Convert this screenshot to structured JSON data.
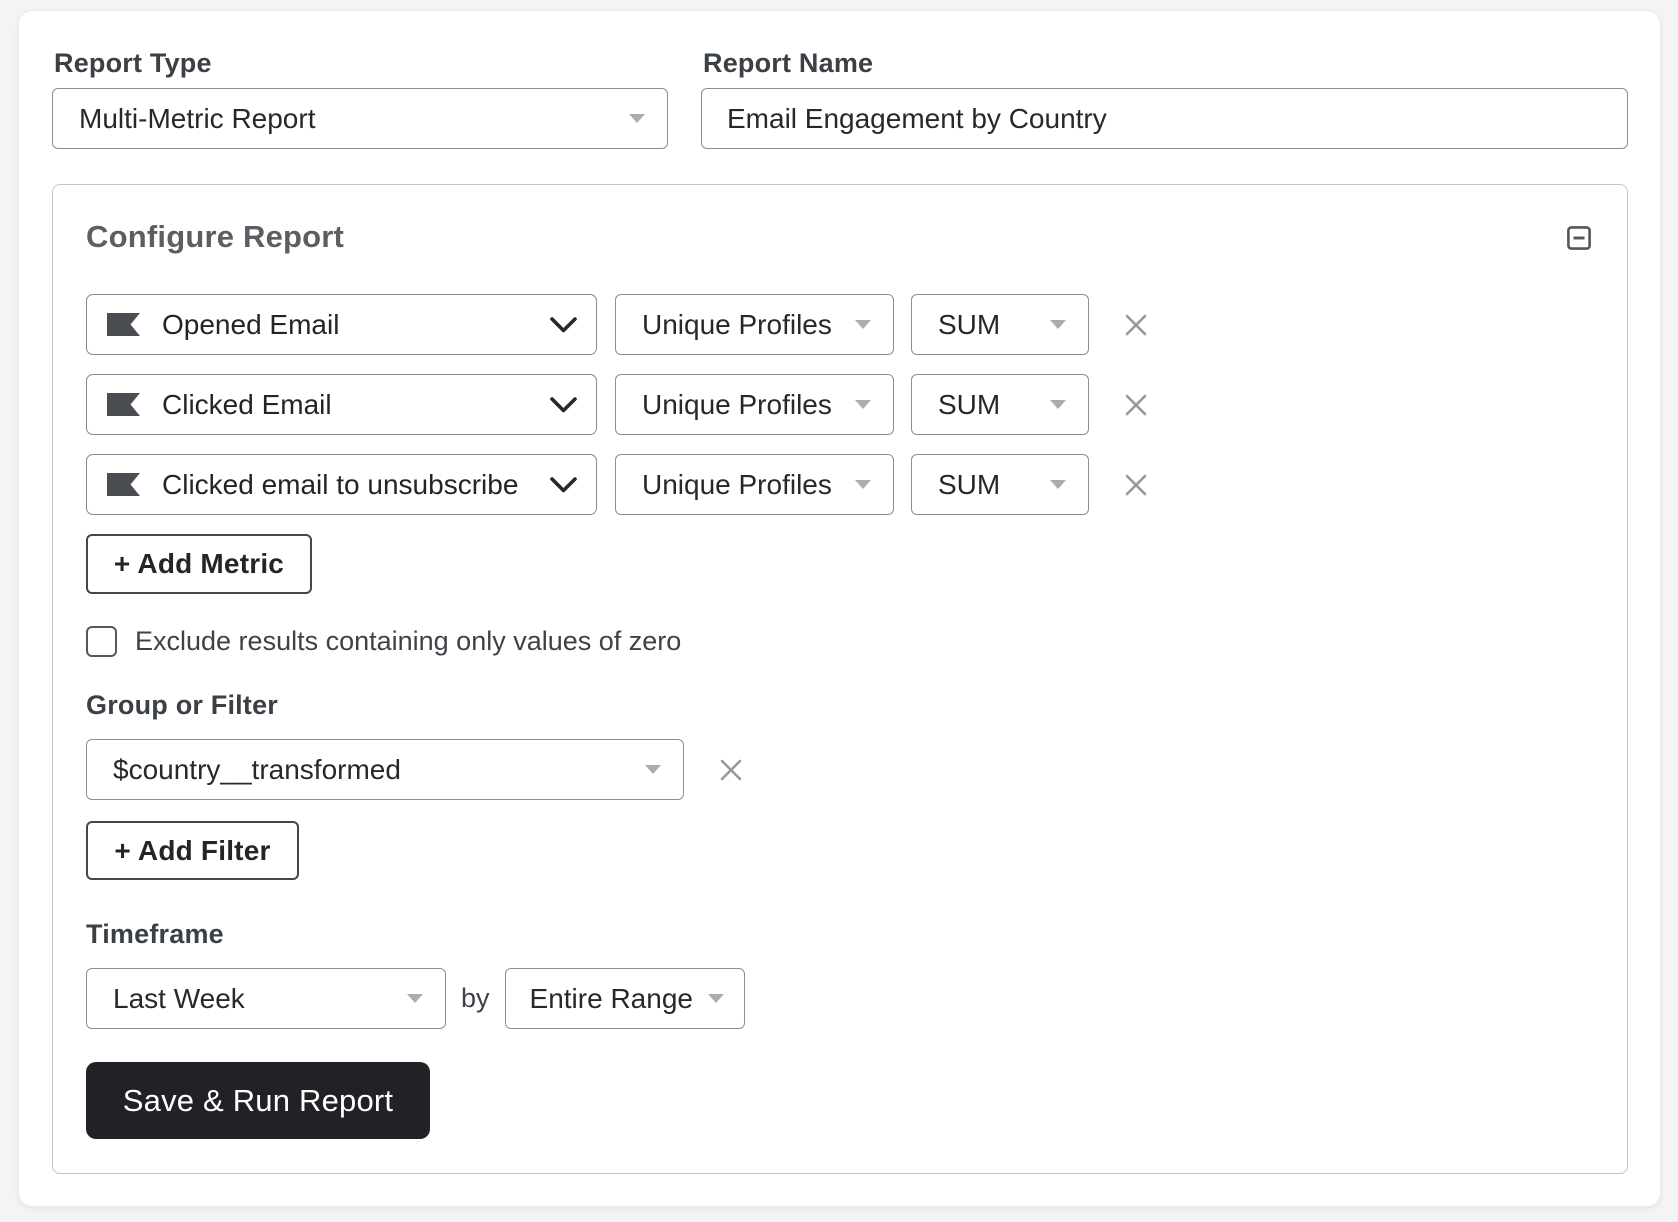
{
  "report_type": {
    "label": "Report Type",
    "value": "Multi-Metric Report"
  },
  "report_name": {
    "label": "Report Name",
    "value": "Email Engagement by Country"
  },
  "configure": {
    "title": "Configure Report",
    "collapse_icon": "minus-square-icon"
  },
  "metrics": {
    "rows": [
      {
        "metric": "Opened Email",
        "dimension": "Unique Profiles",
        "aggregation": "SUM"
      },
      {
        "metric": "Clicked Email",
        "dimension": "Unique Profiles",
        "aggregation": "SUM"
      },
      {
        "metric": "Clicked email to unsubscribe",
        "dimension": "Unique Profiles",
        "aggregation": "SUM"
      }
    ],
    "add_metric_label": "+ Add Metric",
    "metric_icon": "klaviyo-flag-icon",
    "remove_icon": "x-icon"
  },
  "exclude_zero": {
    "label": "Exclude results containing only values of zero",
    "checked": false
  },
  "group_filter": {
    "label": "Group or Filter",
    "value": "$country__transformed",
    "add_filter_label": "+ Add Filter",
    "remove_icon": "x-icon"
  },
  "timeframe": {
    "label": "Timeframe",
    "range_value": "Last Week",
    "by_text": "by",
    "interval_value": "Entire Range"
  },
  "actions": {
    "save_run_label": "Save & Run Report"
  },
  "colors": {
    "page_background": "#f4f4f5",
    "card_background": "#ffffff",
    "control_border": "#8b8e92",
    "inner_card_border": "#c2c5c8",
    "label_text": "#3b4046",
    "value_text": "#26282c",
    "heading_text": "#5b5e62",
    "caret_gray": "#a9adb2",
    "x_icon_gray": "#98999b",
    "flag_icon": "#4a4d51",
    "save_button_background": "#202225",
    "save_button_text": "#ffffff"
  }
}
